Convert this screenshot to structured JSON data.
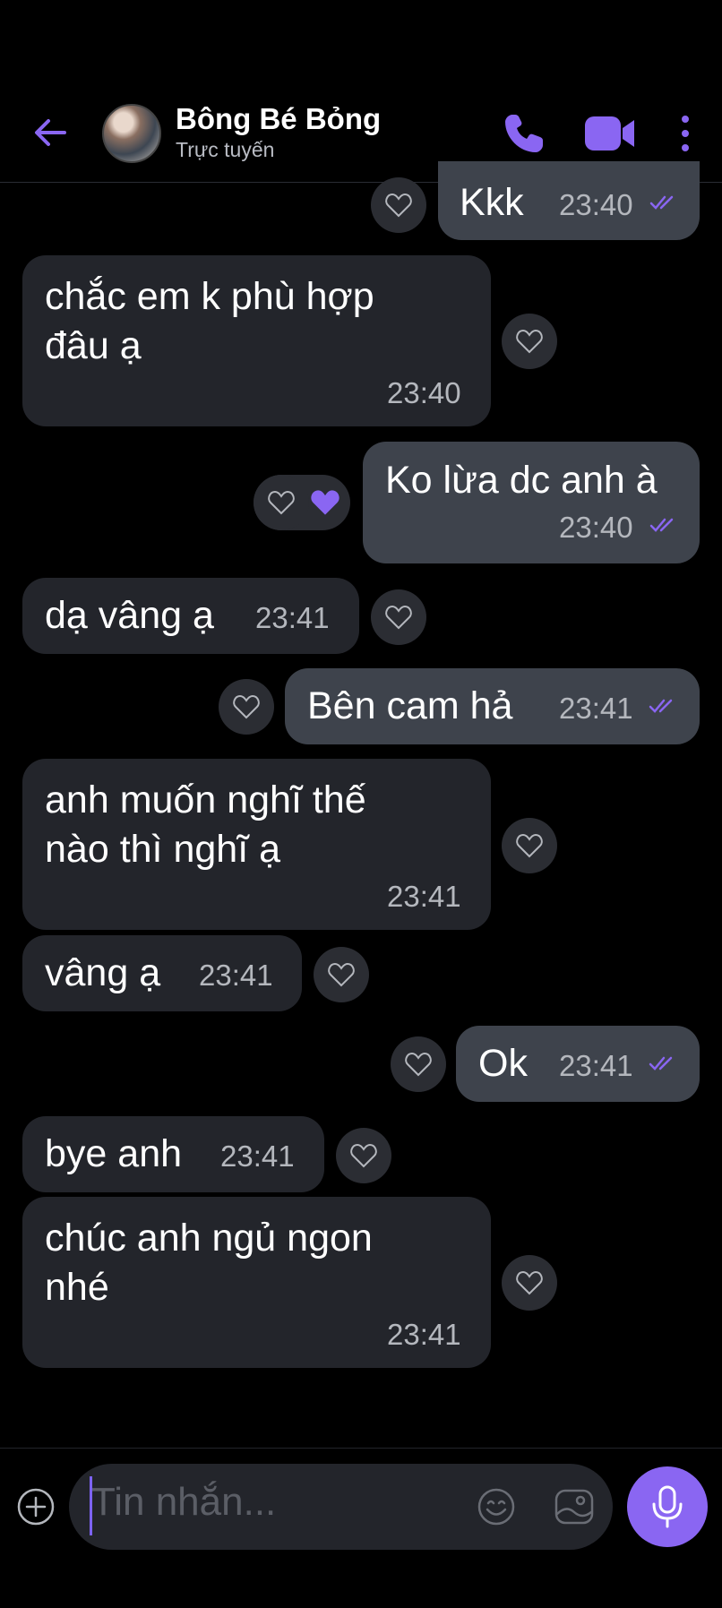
{
  "header": {
    "contact_name": "Bông Bé Bỏng",
    "status": "Trực tuyến"
  },
  "messages": [
    {
      "direction": "out",
      "text": "Kkk",
      "time": "23:40",
      "read": true
    },
    {
      "direction": "in",
      "text_lines": [
        "chắc em k phù hợp",
        "đâu ạ"
      ],
      "time": "23:40"
    },
    {
      "direction": "out",
      "text": "Ko lừa dc anh à",
      "time": "23:40",
      "read": true,
      "liked": true
    },
    {
      "direction": "in",
      "text": "dạ vâng ạ",
      "time": "23:41"
    },
    {
      "direction": "out",
      "text": "Bên cam hả",
      "time": "23:41",
      "read": true
    },
    {
      "direction": "in",
      "text_lines": [
        "anh muốn nghĩ thế",
        "nào thì nghĩ ạ"
      ],
      "time": "23:41"
    },
    {
      "direction": "in",
      "text": "vâng ạ",
      "time": "23:41"
    },
    {
      "direction": "out",
      "text": "Ok",
      "time": "23:41",
      "read": true
    },
    {
      "direction": "in",
      "text": "bye anh",
      "time": "23:41"
    },
    {
      "direction": "in",
      "text_lines": [
        "chúc anh ngủ ngon",
        "nhé"
      ],
      "time": "23:41"
    }
  ],
  "composer": {
    "placeholder": "Tin nhắn..."
  },
  "colors": {
    "accent": "#8a66f2",
    "incoming_bubble": "#23252b",
    "outgoing_bubble": "#3e434c",
    "background": "#000000"
  }
}
